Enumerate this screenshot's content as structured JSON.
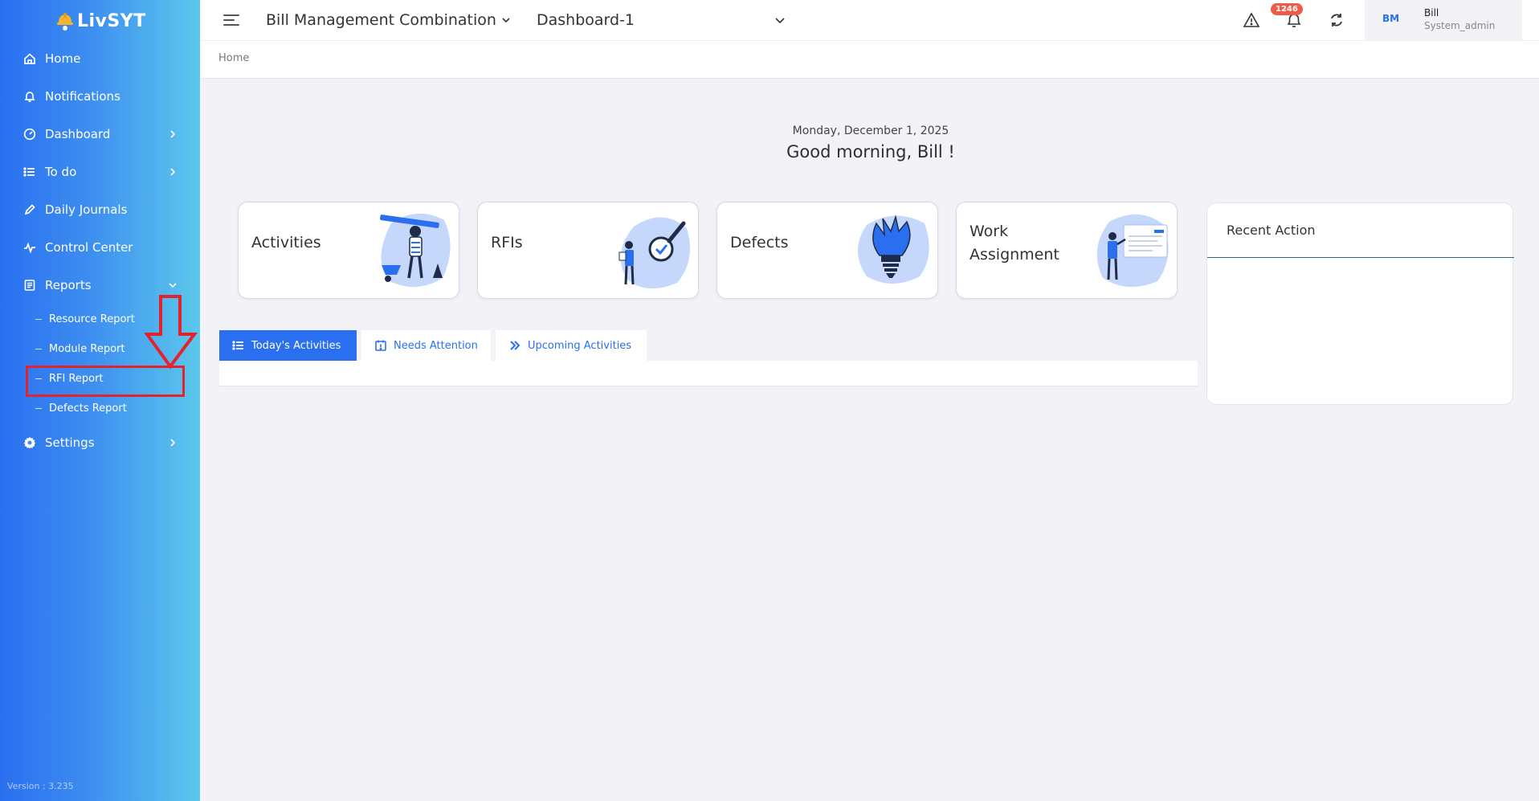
{
  "app": {
    "name": "LivSYT",
    "version": "Version : 3.235"
  },
  "sidebar": {
    "items": [
      {
        "label": "Home",
        "icon": "home-icon"
      },
      {
        "label": "Notifications",
        "icon": "bell-icon"
      },
      {
        "label": "Dashboard",
        "icon": "gauge-icon"
      },
      {
        "label": "To do",
        "icon": "list-icon"
      },
      {
        "label": "Daily Journals",
        "icon": "pencil-icon"
      },
      {
        "label": "Control Center",
        "icon": "pulse-icon"
      },
      {
        "label": "Reports",
        "icon": "report-icon"
      },
      {
        "label": "Settings",
        "icon": "gear-icon"
      }
    ],
    "reports_sub": [
      {
        "label": "Resource Report"
      },
      {
        "label": "Module Report"
      },
      {
        "label": "RFI Report"
      },
      {
        "label": "Defects Report"
      }
    ]
  },
  "header": {
    "project": "Bill Management Combination",
    "dashboard": "Dashboard-1",
    "notification_count": "1246",
    "user": {
      "initials": "BM",
      "name": "Bill",
      "role": "System_admin"
    }
  },
  "breadcrumb": "Home",
  "greeting": {
    "date": "Monday, December 1, 2025",
    "message": "Good morning, Bill !"
  },
  "cards": [
    {
      "title": "Activities"
    },
    {
      "title": "RFIs"
    },
    {
      "title": "Defects"
    },
    {
      "title": "Work Assignment"
    }
  ],
  "recent": {
    "title": "Recent Action"
  },
  "tabs": [
    {
      "label": "Today's Activities"
    },
    {
      "label": "Needs Attention"
    },
    {
      "label": "Upcoming Activities"
    }
  ],
  "colors": {
    "primary": "#2a6ff0",
    "highlight": "#e3222c",
    "badge": "#f05a4a"
  }
}
